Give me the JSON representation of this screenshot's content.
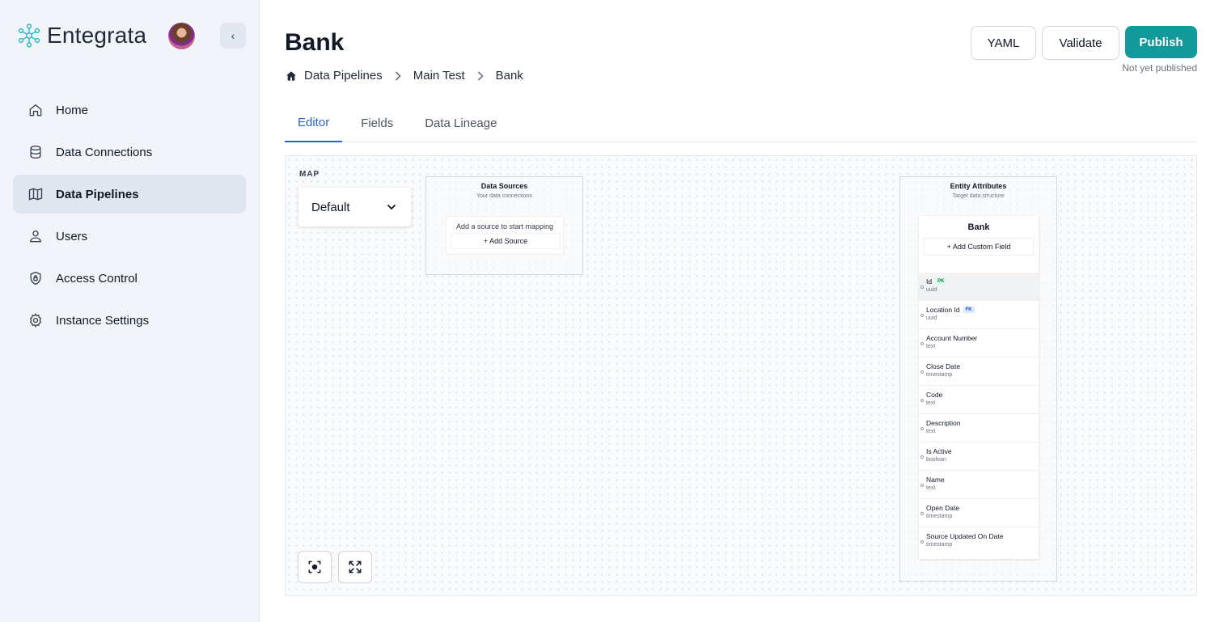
{
  "app": {
    "brand": "Entegrata",
    "colors": {
      "accent": "#12999a",
      "active_tab": "#2b62c8",
      "sidebar_bg": "#f1f5fa"
    }
  },
  "sidebar": {
    "collapse_icon": "chevron-left-icon",
    "items": [
      {
        "label": "Home",
        "icon": "home-icon"
      },
      {
        "label": "Data Connections",
        "icon": "database-icon"
      },
      {
        "label": "Data Pipelines",
        "icon": "map-icon",
        "active": true
      },
      {
        "label": "Users",
        "icon": "user-icon"
      },
      {
        "label": "Access Control",
        "icon": "shield-icon"
      },
      {
        "label": "Instance Settings",
        "icon": "gear-icon"
      }
    ]
  },
  "header": {
    "title": "Bank",
    "breadcrumb": [
      "Data Pipelines",
      "Main Test",
      "Bank"
    ],
    "buttons": {
      "yaml": "YAML",
      "validate": "Validate",
      "publish": "Publish"
    },
    "publish_status": "Not yet published"
  },
  "tabs": [
    {
      "label": "Editor",
      "active": true
    },
    {
      "label": "Fields"
    },
    {
      "label": "Data Lineage"
    }
  ],
  "canvas": {
    "map_label": "MAP",
    "map_select_value": "Default",
    "data_sources": {
      "title": "Data Sources",
      "subtitle": "Your data connections",
      "hint": "Add a source to start mapping",
      "add_label": "+ Add Source"
    },
    "entity_attributes": {
      "title": "Entity Attributes",
      "subtitle": "Target data structure",
      "entity_name": "Bank",
      "add_custom_label": "+ Add Custom Field",
      "fields": [
        {
          "name": "Id",
          "type": "uuid",
          "badge": "PK"
        },
        {
          "name": "Location Id",
          "type": "uuid",
          "badge": "FK"
        },
        {
          "name": "Account Number",
          "type": "text"
        },
        {
          "name": "Close Date",
          "type": "timestamp"
        },
        {
          "name": "Code",
          "type": "text"
        },
        {
          "name": "Description",
          "type": "text"
        },
        {
          "name": "Is Active",
          "type": "boolean"
        },
        {
          "name": "Name",
          "type": "text"
        },
        {
          "name": "Open Date",
          "type": "timestamp"
        },
        {
          "name": "Source Updated On Date",
          "type": "timestamp"
        }
      ]
    },
    "controls": [
      "focus-icon",
      "fullscreen-icon"
    ]
  }
}
